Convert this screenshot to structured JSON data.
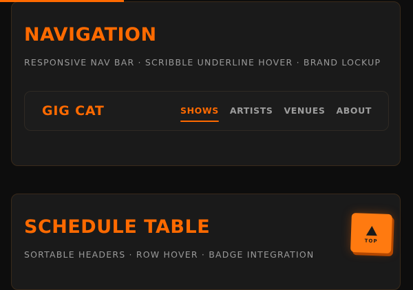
{
  "scroll_progress": 0.3,
  "colors": {
    "accent": "#ff6a00",
    "background": "#0d0d0d",
    "card": "#1a1a1a",
    "muted_text": "#9a9a9a"
  },
  "sections": {
    "navigation": {
      "title": "NAVIGATION",
      "subtitle": "RESPONSIVE NAV BAR · SCRIBBLE UNDERLINE HOVER · BRAND LOCKUP",
      "navbar": {
        "brand": "GIG CAT",
        "links": [
          "SHOWS",
          "ARTISTS",
          "VENUES",
          "ABOUT"
        ],
        "active_link": "SHOWS"
      }
    },
    "schedule": {
      "title": "SCHEDULE TABLE",
      "subtitle": "SORTABLE HEADERS · ROW HOVER · BADGE INTEGRATION"
    }
  },
  "back_to_top": {
    "label": "TOP",
    "icon": "arrow-up-icon"
  }
}
